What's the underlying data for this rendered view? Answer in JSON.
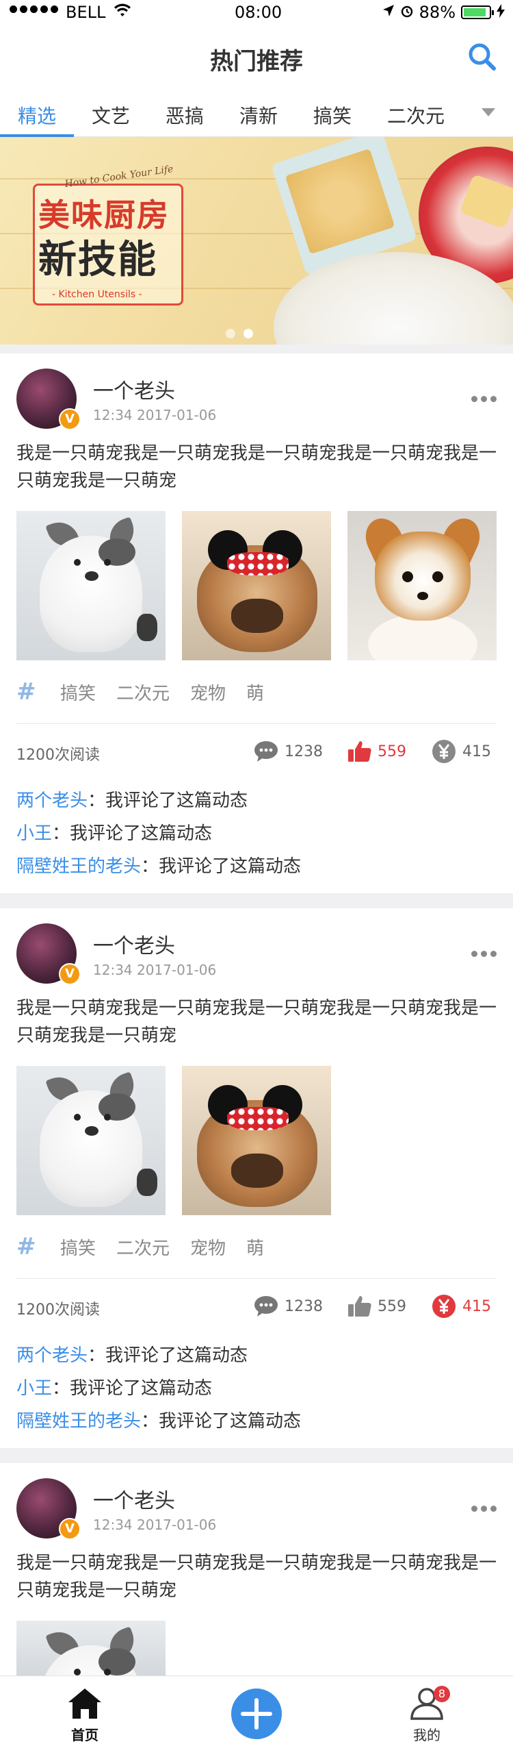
{
  "status_bar": {
    "carrier": "BELL",
    "time": "08:00",
    "battery": "88%",
    "battery_level": 0.88
  },
  "header": {
    "title": "热门推荐",
    "search_icon": "search-icon"
  },
  "tabs": [
    "精选",
    "文艺",
    "恶搞",
    "清新",
    "搞笑",
    "二次元"
  ],
  "banner": {
    "subtitle": "How to Cook Your Life",
    "line1": "美味厨房",
    "line2": "新技能",
    "caption": "- Kitchen Utensils -",
    "page_count": 2,
    "active_page": 2
  },
  "posts": [
    {
      "author": "一个老头",
      "verified": "V",
      "time": "12:34 2017-01-06",
      "text": "我是一只萌宠我是一只萌宠我是一只萌宠我是一只萌宠我是一只萌宠我是一只萌宠",
      "photos": [
        "cat",
        "bulldog",
        "chihuahua"
      ],
      "tags": [
        "搞笑",
        "二次元",
        "宠物",
        "萌"
      ],
      "reads": "1200次阅读",
      "comments_count": "1238",
      "likes": "559",
      "rewards": "415",
      "liked": true,
      "rewarded": false,
      "comments": [
        {
          "name": "两个老头",
          "sep": "：",
          "text": "我评论了这篇动态"
        },
        {
          "name": "小王",
          "sep": "：",
          "text": "我评论了这篇动态"
        },
        {
          "name": "隔壁姓王的老头",
          "sep": "：",
          "text": "我评论了这篇动态"
        }
      ]
    },
    {
      "author": "一个老头",
      "verified": "V",
      "time": "12:34 2017-01-06",
      "text": "我是一只萌宠我是一只萌宠我是一只萌宠我是一只萌宠我是一只萌宠我是一只萌宠",
      "photos": [
        "cat",
        "bulldog"
      ],
      "tags": [
        "搞笑",
        "二次元",
        "宠物",
        "萌"
      ],
      "reads": "1200次阅读",
      "comments_count": "1238",
      "likes": "559",
      "rewards": "415",
      "liked": false,
      "rewarded": true,
      "comments": [
        {
          "name": "两个老头",
          "sep": "：",
          "text": "我评论了这篇动态"
        },
        {
          "name": "小王",
          "sep": "：",
          "text": "我评论了这篇动态"
        },
        {
          "name": "隔壁姓王的老头",
          "sep": "：",
          "text": "我评论了这篇动态"
        }
      ]
    },
    {
      "author": "一个老头",
      "verified": "V",
      "time": "12:34 2017-01-06",
      "text": "我是一只萌宠我是一只萌宠我是一只萌宠我是一只萌宠我是一只萌宠我是一只萌宠",
      "photos": [
        "cat"
      ]
    }
  ],
  "tabbar": {
    "home": "首页",
    "mine": "我的",
    "mine_badge": "8"
  },
  "colors": {
    "accent": "#3a8ee6",
    "like_red": "#e0393e",
    "verified_orange": "#f39a12"
  }
}
